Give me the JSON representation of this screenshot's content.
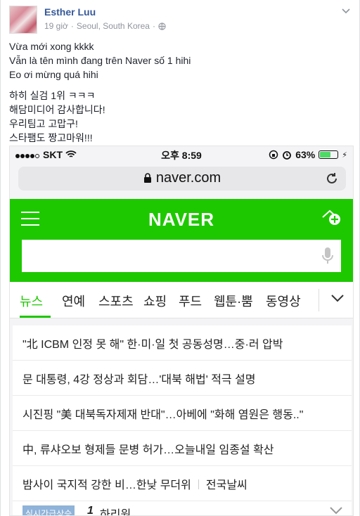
{
  "post": {
    "author": "Esther Luu",
    "time": "19 giờ",
    "location": "Seoul, South Korea",
    "separator": "·",
    "lines": [
      "Vừa mới xong kkkk",
      "Vẫn là tên mình đang trên Naver số 1 hihi",
      "Eo ơi mừng quá hihi"
    ],
    "lines_ko": [
      "하히 실검 1위 ㅋㅋㅋ",
      "해담미디어 감사합니다!",
      "우리팀고 고맙구!",
      "스타팸도 짱고마워!!!"
    ]
  },
  "screenshot": {
    "status": {
      "carrier": "SKT",
      "time": "오후 8:59",
      "battery": "63%",
      "battery_level": 0.63
    },
    "url": "naver.com",
    "logo": "NAVER",
    "tabs": [
      "뉴스",
      "연예",
      "스포츠",
      "쇼핑",
      "푸드",
      "웹툰·뿜",
      "동영상"
    ],
    "news": [
      "\"北 ICBM 인정 못 해\" 한·미·일 첫 공동성명…중·러 압박",
      "문 대통령, 4강 정상과 회담…'대북 해법' 적극 설명",
      "시진핑 \"美 대북독자제재 반대\"…아베에 \"화해 염원은 행동..\"",
      "中, 류샤오보 형제들 문병 허가…오늘내일 임종설 확산",
      "밤사이 국지적 강한 비…한낮 무더위"
    ],
    "news_extra": "전국날씨",
    "rank_badge": "실시간급상승",
    "rank_num": "1",
    "rank_keyword": "하리원"
  },
  "icons": [
    "chevron-down-icon",
    "globe-icon",
    "wifi-icon",
    "lock-icon",
    "reload-icon",
    "menu-icon",
    "add-home-icon",
    "mic-icon",
    "alarm-icon"
  ],
  "colors": {
    "naver_green": "#1ec800",
    "link_blue": "#365899",
    "meta_gray": "#90949c"
  }
}
